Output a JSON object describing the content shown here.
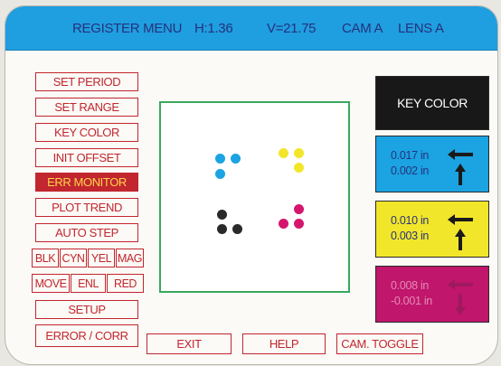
{
  "header": {
    "title": "REGISTER MENU",
    "h_readout": "H:1.36",
    "v_readout": "V=21.75",
    "camera": "CAM A",
    "lens": "LENS A",
    "background_color": "#1f9ee0",
    "text_color": "#26327c"
  },
  "menu": {
    "set_period": "SET PERIOD",
    "set_range": "SET RANGE",
    "key_color": "KEY COLOR",
    "init_offset": "INIT OFFSET",
    "err_monitor": "ERR MONITOR",
    "plot_trend": "PLOT TREND",
    "auto_step": "AUTO STEP",
    "setup": "SETUP",
    "error_corr": "ERROR / CORR",
    "active_item": "ERR MONITOR",
    "accent_color": "#c2262e",
    "active_text_color": "#ffd54a"
  },
  "color_select": {
    "blk": "BLK",
    "cyn": "CYN",
    "yel": "YEL",
    "mag": "MAG"
  },
  "zoom": {
    "move": "MOVE",
    "enl": "ENL",
    "red": "RED"
  },
  "bottom_bar": {
    "exit": "EXIT",
    "help": "HELP",
    "cam_toggle": "CAM. TOGGLE"
  },
  "viewer": {
    "border_color": "#39a85d",
    "mark_groups": [
      {
        "color_name": "cyan",
        "color": "#1ba3e2",
        "dots": 3
      },
      {
        "color_name": "yellow",
        "color": "#f2e62a",
        "dots": 3
      },
      {
        "color_name": "black",
        "color": "#2a2a2a",
        "dots": 3
      },
      {
        "color_name": "magenta",
        "color": "#d4166e",
        "dots": 3
      }
    ]
  },
  "panels": {
    "key_color": {
      "label": "KEY COLOR",
      "color": "#181818",
      "text_color": "#ffffff"
    },
    "cyan": {
      "color": "#1ba3e2",
      "text_color": "#26327c",
      "horizontal": "0.017 in",
      "vertical": "0.002 in",
      "h_arrow": "left-arrow-icon",
      "v_arrow": "up-arrow-icon"
    },
    "yellow": {
      "color": "#f2e62a",
      "text_color": "#26327c",
      "horizontal": "0.010 in",
      "vertical": "0.003 in",
      "h_arrow": "left-arrow-icon",
      "v_arrow": "up-arrow-icon"
    },
    "magenta": {
      "color": "#c0166b",
      "text_color": "#e48ab8",
      "horizontal": "0.008 in",
      "vertical": "-0.001 in",
      "h_arrow": "left-arrow-icon",
      "v_arrow": "down-arrow-icon"
    }
  }
}
